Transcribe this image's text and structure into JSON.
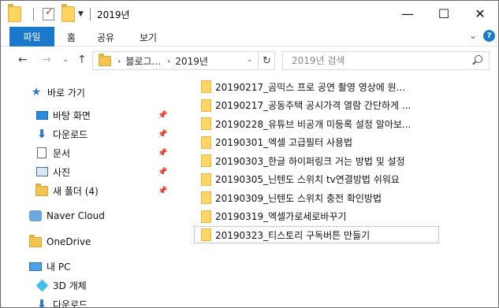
{
  "window": {
    "title": "2019년",
    "controls": {
      "minimize": "—",
      "maximize": "☐",
      "close": "✕"
    }
  },
  "ribbon": {
    "file_tab": "파일",
    "tabs": [
      "홈",
      "공유",
      "보기"
    ],
    "expand": "⌄",
    "help": "?"
  },
  "nav": {
    "back": "←",
    "forward": "→",
    "recent": "⌄",
    "up": "↑",
    "breadcrumb": [
      "블로그...",
      "2019년"
    ],
    "refresh": "↻",
    "address_dropdown": "⌄",
    "search_placeholder": "2019년 검색"
  },
  "sidebar": {
    "quick_access": "바로 가기",
    "pinned": [
      {
        "label": "바탕 화면",
        "icon": "desktop-icon"
      },
      {
        "label": "다운로드",
        "icon": "download-icon"
      },
      {
        "label": "문서",
        "icon": "document-icon"
      },
      {
        "label": "사진",
        "icon": "picture-icon"
      },
      {
        "label": "새 폴더 (4)",
        "icon": "folder-icon"
      }
    ],
    "naver_cloud": "Naver Cloud",
    "onedrive": "OneDrive",
    "this_pc": "내 PC",
    "objects3d": "3D 개체",
    "downloads2": "다운로드"
  },
  "files": [
    "20190217_곰믹스 프로 공연 촬영 영상에 원...",
    "20190217_공동주택 공시가격 열람 간단하게 ...",
    "20190228_유튜브 비공개 미등록 설정 알아보...",
    "20190301_엑셀 고급필터 사용법",
    "20190303_한글 하이퍼링크 거는 방법 및 설정",
    "20190305_닌텐도 스위치 tv연결방법 쉬워요",
    "20190309_닌텐도 스위치 충전 확인방법",
    "20190319_엑셀가로세로바꾸기",
    "20190323_티스토리 구독버튼 만들기"
  ],
  "selected_index": 8
}
